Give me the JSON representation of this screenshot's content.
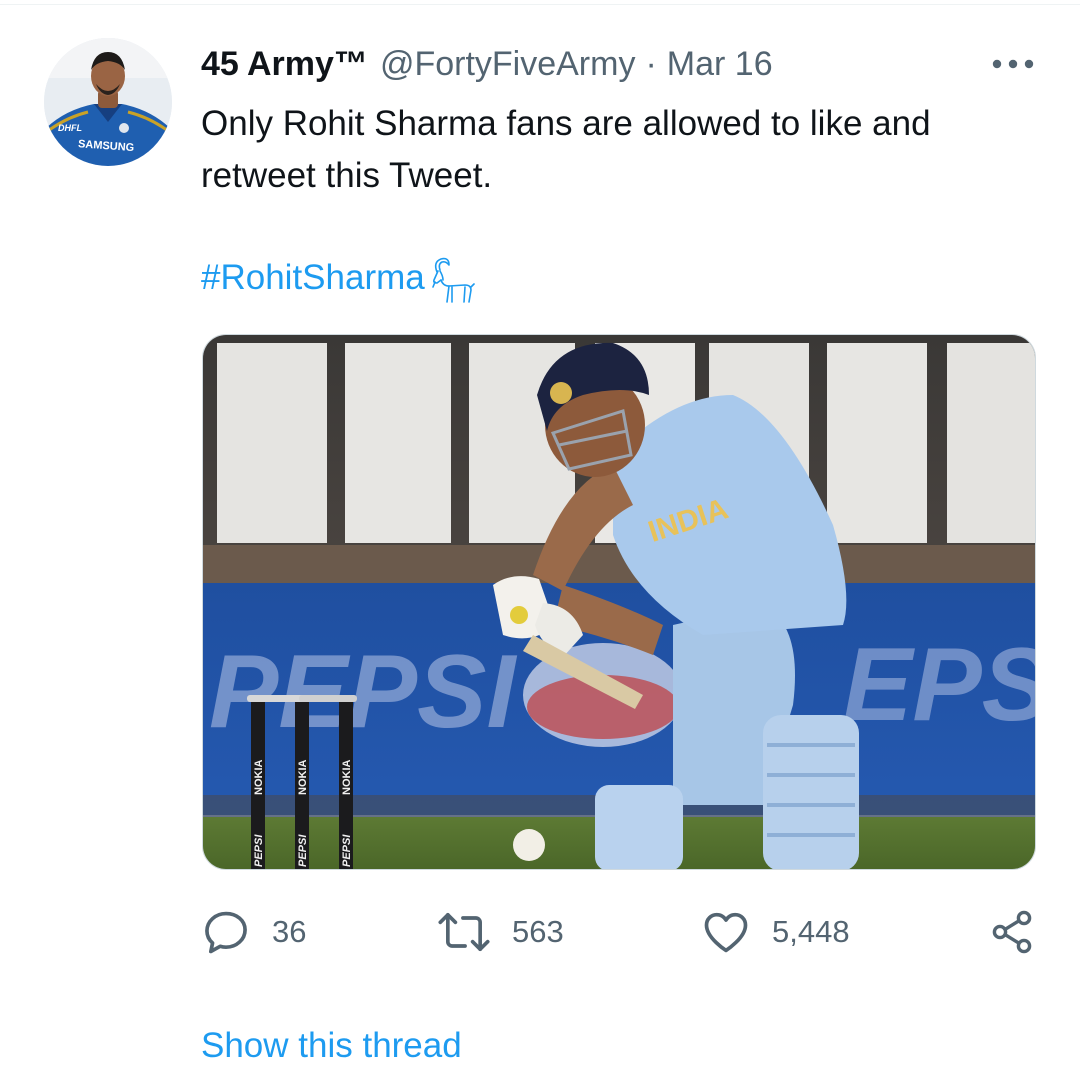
{
  "tweet": {
    "display_name": "45 Army™",
    "handle": "@FortyFiveArmy",
    "separator": "·",
    "date": "Mar 16",
    "text_line1": "Only Rohit Sharma fans are allowed to like and",
    "text_line2": "retweet this Tweet.",
    "hashtag": "#RohitSharma"
  },
  "avatar": {
    "jersey_sponsor": "SAMSUNG",
    "jersey_patch": "DHFL"
  },
  "media": {
    "jersey_text": "INDIA",
    "board_text": "PEPSI",
    "stump_text_1": "NOKIA",
    "stump_text_2": "PEPSI"
  },
  "actions": {
    "replies": "36",
    "retweets": "563",
    "likes": "5,448"
  },
  "show_thread": "Show this thread",
  "colors": {
    "link": "#1d9bf0",
    "secondary_text": "#536471",
    "primary_text": "#0f1419"
  },
  "icons": {
    "more": "more-horizontal-icon",
    "reply": "reply-bubble-icon",
    "retweet": "retweet-icon",
    "like": "heart-icon",
    "share": "share-icon",
    "hashtag_emoji": "goat-icon"
  }
}
